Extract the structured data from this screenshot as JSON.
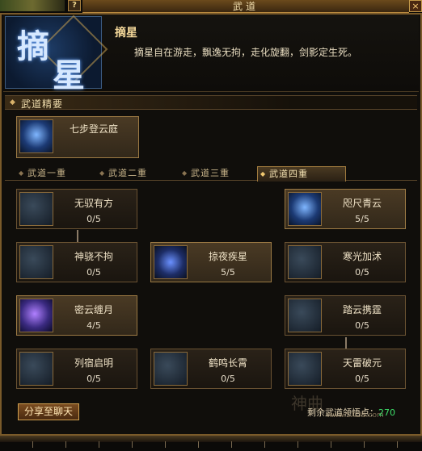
{
  "window": {
    "title": "武道",
    "help_label": "?",
    "close_label": "×"
  },
  "header": {
    "emblem_chars": [
      "摘",
      "星"
    ],
    "style_name": "摘星",
    "description": "摘星自在游走，飘逸无拘，走化旋翻，剑影定生死。"
  },
  "section": {
    "title": "武道精要"
  },
  "featured": {
    "name": "七步登云庭",
    "icon": "cloud-step-icon"
  },
  "tabs": [
    {
      "label": "武道一重",
      "active": false
    },
    {
      "label": "武道二重",
      "active": false
    },
    {
      "label": "武道三重",
      "active": false
    },
    {
      "label": "武道四重",
      "active": true
    }
  ],
  "skills": [
    {
      "name": "无驭有方",
      "level": "0/5",
      "icon": "scroll-icon"
    },
    {
      "name": "咫尺青云",
      "level": "5/5",
      "icon": "blue-figure-icon"
    },
    {
      "name": "神骁不拘",
      "level": "0/5",
      "icon": "swirl-icon"
    },
    {
      "name": "掠夜疾星",
      "level": "5/5",
      "icon": "stars-icon"
    },
    {
      "name": "寒光加沭",
      "level": "0/5",
      "icon": "blade-icon"
    },
    {
      "name": "密云缠月",
      "level": "4/5",
      "icon": "moon-swirl-icon"
    },
    {
      "name": "踏云携霆",
      "level": "0/5",
      "icon": "thunder-icon"
    },
    {
      "name": "列宿启明",
      "level": "0/5",
      "icon": "constellation-icon"
    },
    {
      "name": "鹤鸣长霄",
      "level": "0/5",
      "icon": "crane-icon"
    },
    {
      "name": "天雷破元",
      "level": "0/5",
      "icon": "lightning-icon"
    }
  ],
  "footer": {
    "share_label": "分享至聊天",
    "points_label": "剩余武道领悟点：",
    "points_value": "270",
    "watermark": "神曲",
    "watermark_url": "www.SXDS.com"
  },
  "colors": {
    "accent": "#d0a050",
    "points": "#3ee06a",
    "panel": "#100e0b"
  }
}
